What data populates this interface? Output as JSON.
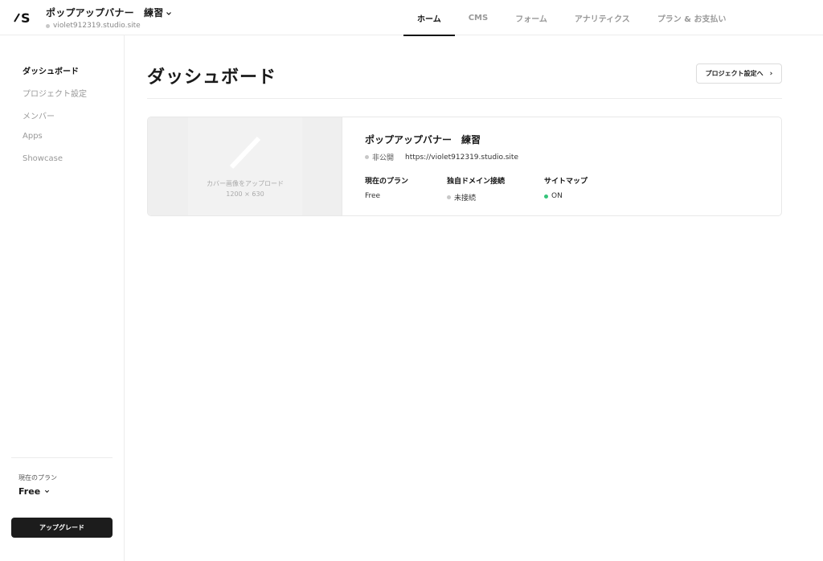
{
  "header": {
    "project_name": "ポップアップバナー　練習",
    "project_url": "violet912319.studio.site",
    "tabs": [
      {
        "label": "ホーム"
      },
      {
        "label": "CMS"
      },
      {
        "label": "フォーム"
      },
      {
        "label": "アナリティクス"
      },
      {
        "label": "プラン & お支払い"
      }
    ],
    "active_tab": "ホーム"
  },
  "sidebar": {
    "items": [
      {
        "label": "ダッシュボード"
      },
      {
        "label": "プロジェクト設定"
      },
      {
        "label": "メンバー"
      },
      {
        "label": "Apps"
      },
      {
        "label": "Showcase"
      }
    ],
    "active_item": "ダッシュボード",
    "plan_label": "現在のプラン",
    "plan_value": "Free",
    "upgrade_label": "アップグレード"
  },
  "main": {
    "title": "ダッシュボード",
    "settings_button": "プロジェクト設定へ",
    "card": {
      "cover_text": "カバー画像をアップロード",
      "cover_size": "1200 × 630",
      "title": "ポップアップバナー　練習",
      "status": "非公開",
      "url": "https://violet912319.studio.site",
      "meta": [
        {
          "label": "現在のプラン",
          "value": "Free",
          "dot": "none"
        },
        {
          "label": "独自ドメイン接続",
          "value": "未接続",
          "dot": "gray"
        },
        {
          "label": "サイトマップ",
          "value": "ON",
          "dot": "green"
        }
      ]
    }
  },
  "colors": {
    "accent_dark": "#1c1c1c",
    "status_green": "#35c47a",
    "muted_gray": "#999999"
  }
}
